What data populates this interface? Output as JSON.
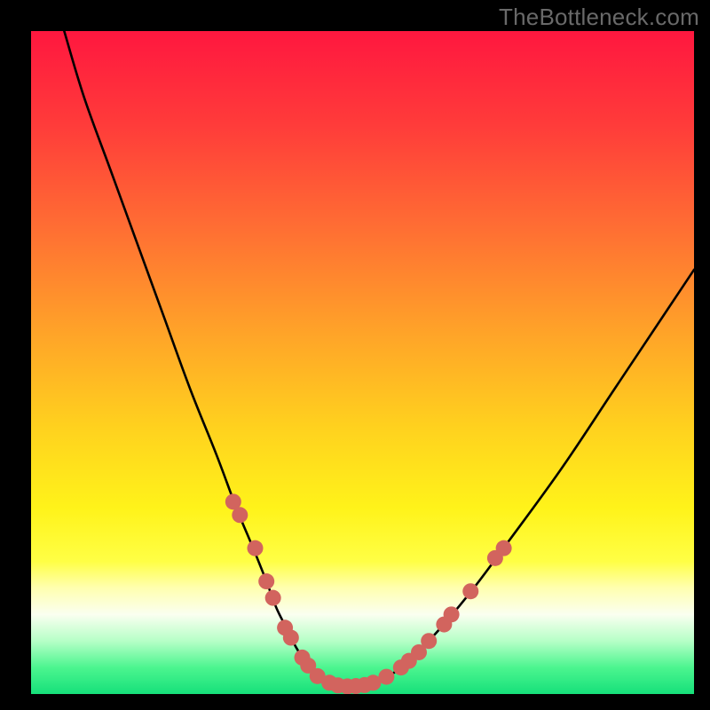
{
  "watermark": "TheBottleneck.com",
  "frame": {
    "outer_w": 800,
    "outer_h": 800,
    "margin_left": 35,
    "margin_right": 18,
    "margin_top": 35,
    "margin_bottom": 18
  },
  "gradient_stops": [
    {
      "pct": 0,
      "color": "#ff173f"
    },
    {
      "pct": 14,
      "color": "#ff3b3a"
    },
    {
      "pct": 30,
      "color": "#ff6f33"
    },
    {
      "pct": 46,
      "color": "#ffa528"
    },
    {
      "pct": 60,
      "color": "#ffd21e"
    },
    {
      "pct": 72,
      "color": "#fff31a"
    },
    {
      "pct": 80,
      "color": "#ffff45"
    },
    {
      "pct": 84,
      "color": "#ffffb0"
    },
    {
      "pct": 88,
      "color": "#fafff0"
    },
    {
      "pct": 92,
      "color": "#b6ffc7"
    },
    {
      "pct": 96,
      "color": "#4cf58f"
    },
    {
      "pct": 100,
      "color": "#16e07a"
    }
  ],
  "chart_data": {
    "type": "line",
    "title": "",
    "xlabel": "",
    "ylabel": "",
    "xlim": [
      0,
      100
    ],
    "ylim": [
      0,
      100
    ],
    "annotations": [],
    "series": [
      {
        "name": "curve",
        "x": [
          5,
          8,
          12,
          16,
          20,
          24,
          28,
          31,
          33.5,
          35.5,
          37,
          38.5,
          40,
          42,
          44,
          46,
          48,
          50,
          53,
          56,
          60,
          66,
          72,
          80,
          88,
          96,
          100
        ],
        "y": [
          100,
          90,
          79,
          68,
          57,
          46,
          36,
          28,
          22,
          17,
          13,
          10,
          7,
          4,
          2.2,
          1.4,
          1.1,
          1.3,
          2.2,
          4.2,
          8,
          15,
          23,
          34,
          46,
          58,
          64
        ]
      }
    ],
    "scatter": {
      "name": "markers",
      "color": "#d2645e",
      "radius_px": 9,
      "points": [
        {
          "x": 30.5,
          "y": 29
        },
        {
          "x": 31.5,
          "y": 27
        },
        {
          "x": 33.8,
          "y": 22
        },
        {
          "x": 35.5,
          "y": 17
        },
        {
          "x": 36.5,
          "y": 14.5
        },
        {
          "x": 38.3,
          "y": 10
        },
        {
          "x": 39.2,
          "y": 8.5
        },
        {
          "x": 40.9,
          "y": 5.5
        },
        {
          "x": 41.8,
          "y": 4.3
        },
        {
          "x": 43.2,
          "y": 2.7
        },
        {
          "x": 45.0,
          "y": 1.7
        },
        {
          "x": 46.3,
          "y": 1.3
        },
        {
          "x": 47.7,
          "y": 1.15
        },
        {
          "x": 49.0,
          "y": 1.2
        },
        {
          "x": 50.3,
          "y": 1.35
        },
        {
          "x": 51.6,
          "y": 1.7
        },
        {
          "x": 53.6,
          "y": 2.6
        },
        {
          "x": 55.8,
          "y": 4.0
        },
        {
          "x": 57.0,
          "y": 5.0
        },
        {
          "x": 58.5,
          "y": 6.3
        },
        {
          "x": 60.0,
          "y": 8.0
        },
        {
          "x": 62.3,
          "y": 10.5
        },
        {
          "x": 63.4,
          "y": 12.0
        },
        {
          "x": 66.3,
          "y": 15.5
        },
        {
          "x": 70.0,
          "y": 20.5
        },
        {
          "x": 71.3,
          "y": 22.0
        }
      ]
    }
  }
}
